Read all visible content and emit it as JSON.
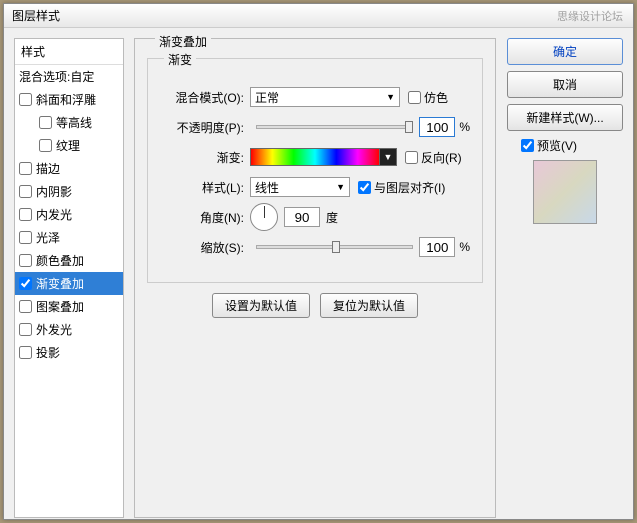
{
  "window_title": "图层样式",
  "watermark": "思缘设计论坛",
  "sidebar": {
    "header": "样式",
    "blend_options": "混合选项:自定",
    "items": [
      {
        "label": "斜面和浮雕",
        "checked": false,
        "indent": false
      },
      {
        "label": "等高线",
        "checked": false,
        "indent": true
      },
      {
        "label": "纹理",
        "checked": false,
        "indent": true
      },
      {
        "label": "描边",
        "checked": false,
        "indent": false
      },
      {
        "label": "内阴影",
        "checked": false,
        "indent": false
      },
      {
        "label": "内发光",
        "checked": false,
        "indent": false
      },
      {
        "label": "光泽",
        "checked": false,
        "indent": false
      },
      {
        "label": "颜色叠加",
        "checked": false,
        "indent": false
      },
      {
        "label": "渐变叠加",
        "checked": true,
        "indent": false,
        "selected": true
      },
      {
        "label": "图案叠加",
        "checked": false,
        "indent": false
      },
      {
        "label": "外发光",
        "checked": false,
        "indent": false
      },
      {
        "label": "投影",
        "checked": false,
        "indent": false
      }
    ]
  },
  "main": {
    "title": "渐变叠加",
    "sub_title": "渐变",
    "blend_mode_label": "混合模式(O):",
    "blend_mode_value": "正常",
    "dither_label": "仿色",
    "opacity_label": "不透明度(P):",
    "opacity_value": "100",
    "pct": "%",
    "gradient_label": "渐变:",
    "reverse_label": "反向(R)",
    "style_label": "样式(L):",
    "style_value": "线性",
    "align_label": "与图层对齐(I)",
    "angle_label": "角度(N):",
    "angle_value": "90",
    "deg": "度",
    "scale_label": "缩放(S):",
    "scale_value": "100",
    "set_default": "设置为默认值",
    "reset_default": "复位为默认值"
  },
  "right": {
    "ok": "确定",
    "cancel": "取消",
    "new_style": "新建样式(W)...",
    "preview_label": "预览(V)"
  }
}
